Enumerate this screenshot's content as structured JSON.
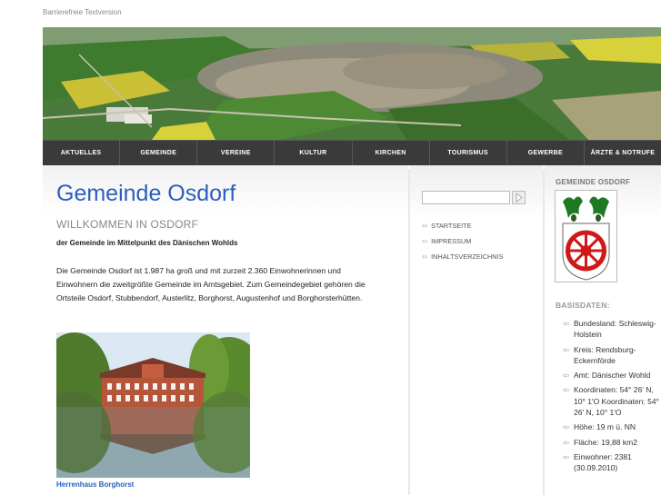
{
  "skip_link": "Barrierefreie Textversion",
  "nav": [
    "AKTUELLES",
    "GEMEINDE",
    "VEREINE",
    "KULTUR",
    "KIRCHEN",
    "TOURISMUS",
    "GEWERBE",
    "ÄRZTE & NOTRUFE"
  ],
  "main": {
    "title": "Gemeinde Osdorf",
    "welcome": "WILLKOMMEN IN OSDORF",
    "subtitle": "der Gemeinde im Mittelpunkt des Dänischen Wohlds",
    "intro": "Die Gemeinde Osdorf ist 1.987 ha groß und mit zurzeit 2.360 Einwohnerinnen und Einwohnern die zweitgrößte Gemeinde im Amtsgebiet. Zum Gemeindegebiet gehören die Ortsteile Osdorf, Stubbendorf, Austerlitz, Borghorst, Augustenhof und Borghorsterhütten.",
    "caption": "Herrenhaus Borghorst"
  },
  "sidebar": {
    "links": [
      "STARTSEITE",
      "IMPRESSUM",
      "INHALTSVERZEICHNIS"
    ],
    "arrow": "⇦"
  },
  "right": {
    "heading": "GEMEINDE OSDORF",
    "basis_heading": "BASISDATEN:",
    "basis": [
      "Bundesland: Schleswig-Holstein",
      "Kreis: Rendsburg-Eckernförde",
      "Amt: Dänischer Wohld",
      "Koordinaten: 54° 26' N, 10° 1'O Koordinaten: 54° 26' N, 10° 1'O",
      "Höhe: 19 m ü. NN",
      "Fläche: 19,88 km2",
      "Einwohner: 2381 (30.09.2010)"
    ]
  }
}
